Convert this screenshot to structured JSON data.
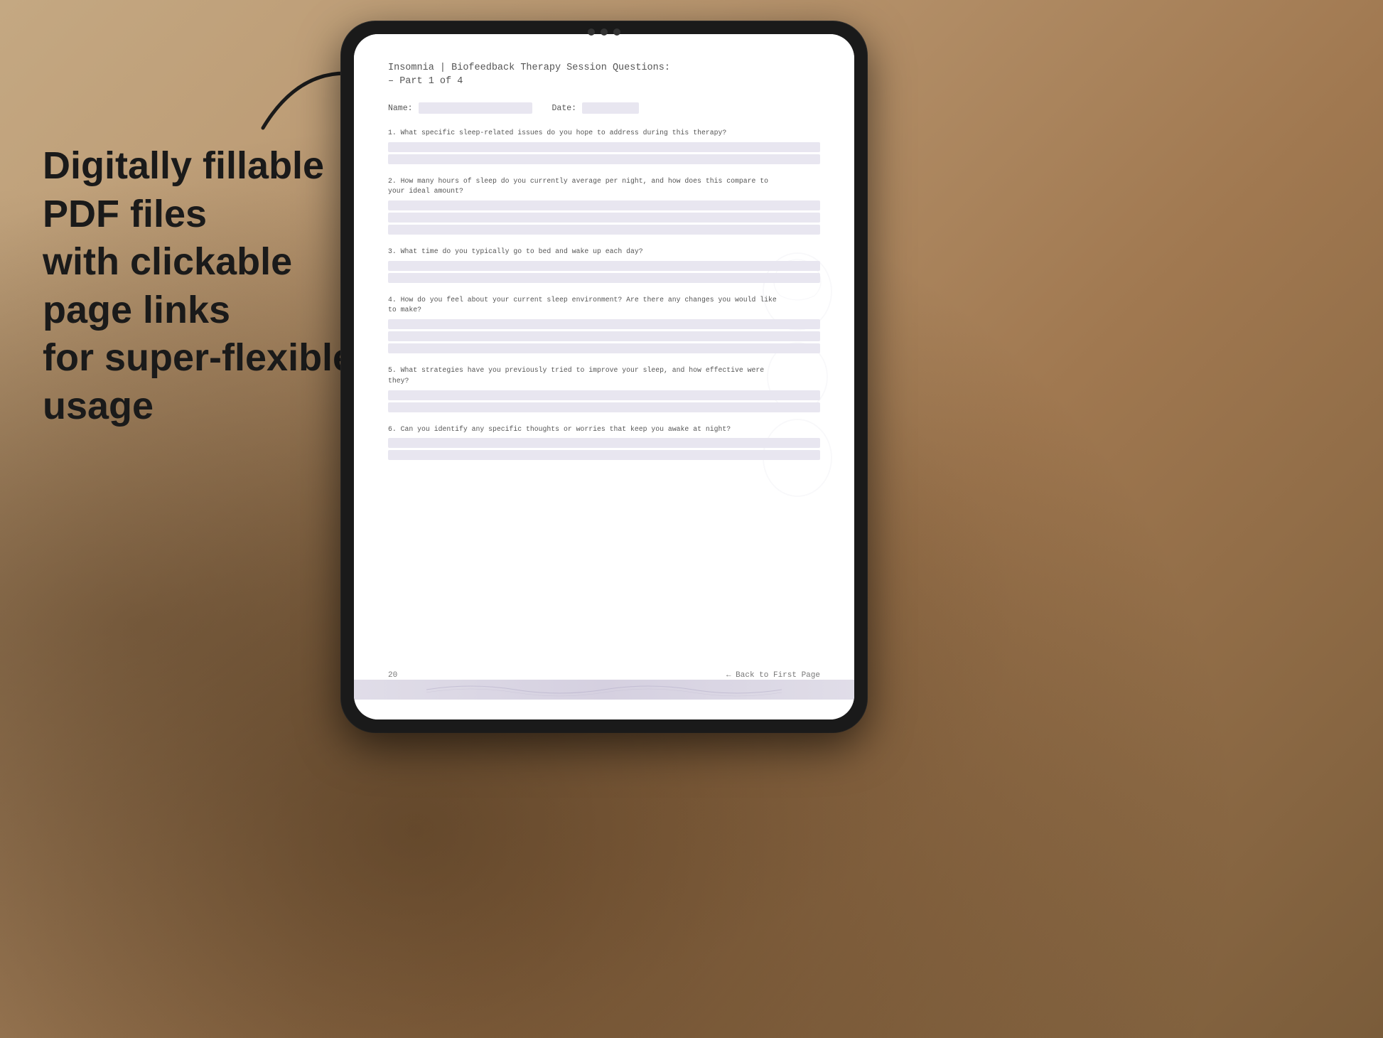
{
  "background": {
    "color_start": "#c4a882",
    "color_end": "#7a5c3a"
  },
  "left_text": {
    "line1": "Digitally fillable PDF files",
    "line2": "with clickable page links",
    "line3": "for super-flexible usage"
  },
  "arrow": {
    "label": "arrow-pointing-right"
  },
  "tablet": {
    "camera_dots": 3
  },
  "pdf": {
    "title": "Insomnia | Biofeedback Therapy Session Questions:",
    "subtitle": "– Part 1 of 4",
    "name_label": "Name:",
    "date_label": "Date:",
    "questions": [
      {
        "number": "1.",
        "text": "What specific sleep-related issues do you hope to address during this therapy?"
      },
      {
        "number": "2.",
        "text": "How many hours of sleep do you currently average per night, and how does this compare to\nyour ideal amount?"
      },
      {
        "number": "3.",
        "text": "What time do you typically go to bed and wake up each day?"
      },
      {
        "number": "4.",
        "text": "How do you feel about your current sleep environment? Are there any changes you would like\nto make?"
      },
      {
        "number": "5.",
        "text": "What strategies have you previously tried to improve your sleep, and how effective were\nthey?"
      },
      {
        "number": "6.",
        "text": "Can you identify any specific thoughts or worries that keep you awake at night?"
      }
    ],
    "page_number": "20",
    "back_link": "← Back to First Page"
  }
}
